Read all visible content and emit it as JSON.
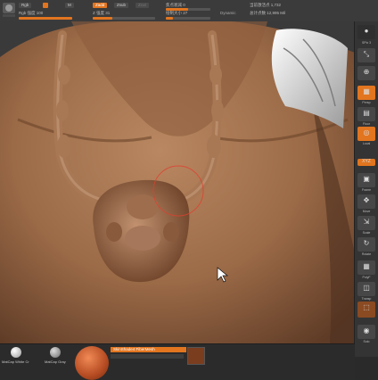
{
  "toolbar": {
    "rgb_label": "Rgb",
    "m_label": "M",
    "zadd_label": "Zadd",
    "zsub_label": "Zsub",
    "zcut_label": "Zcut",
    "rgb_intensity": "Rgb 强度 100",
    "z_intensity": "Z 强度 31",
    "focal_shift": "焦点衰减 0",
    "draw_size": "绘制大小 27",
    "dynamic_label": "Dynamic",
    "active_points": "当前激活点 1,732",
    "total_points": "总计点数 12,995 Mil",
    "accent_color": "#e2751f"
  },
  "shelf": {
    "labels": [
      "SPix 3",
      "Persp",
      "Floor",
      "Local",
      "Frame",
      "Move",
      "Scale",
      "Rotate",
      "PolyF",
      "Transp",
      "Solo"
    ]
  },
  "bottom": {
    "mat1_label": "MatCap White Cr",
    "mat2_label": "MatCap Gray",
    "material_field": "SkinShade4 FiberMesh"
  }
}
